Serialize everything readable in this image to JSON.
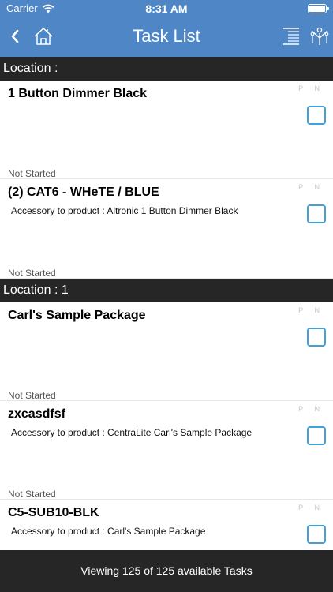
{
  "status_bar": {
    "carrier": "Carrier",
    "time": "8:31 AM"
  },
  "navbar": {
    "title": "Task List"
  },
  "icons": {
    "back": "chevron-left-icon",
    "home": "home-icon",
    "list": "list-icon",
    "people": "people-icon",
    "wifi": "wifi-icon",
    "battery": "battery-icon"
  },
  "colors": {
    "nav_bar": "#4f86c6",
    "section_bar": "#262626",
    "checkbox": "#42a0d4"
  },
  "pn_label": "P N",
  "sections": [
    {
      "label": "Location :",
      "tasks": [
        {
          "title": "1 Button Dimmer Black",
          "desc": "",
          "status": "Not Started"
        },
        {
          "title": "(2) CAT6 - WHeTE / BLUE",
          "desc": "Accessory to product : Altronic 1 Button Dimmer Black",
          "status": "Not Started"
        }
      ]
    },
    {
      "label": "Location : 1",
      "tasks": [
        {
          "title": "Carl's Sample Package",
          "desc": "",
          "status": "Not Started"
        },
        {
          "title": "zxcasdfsf",
          "desc": "Accessory to product : CentraLite Carl's Sample Package",
          "status": "Not Started"
        },
        {
          "title": "C5-SUB10-BLK",
          "desc": "Accessory to product :   Carl's Sample Package",
          "status": ""
        }
      ]
    }
  ],
  "footer": {
    "text": "Viewing 125 of 125 available Tasks"
  }
}
